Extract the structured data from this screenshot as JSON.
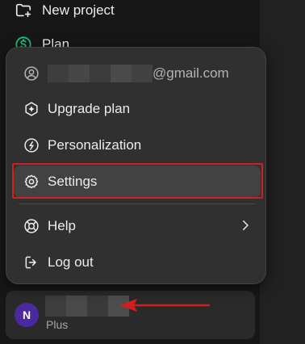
{
  "sidebar": {
    "new_project": {
      "label": "New project",
      "icon": "folder-plus-icon"
    },
    "plan": {
      "label": "Plan",
      "icon": "dollar-circle-icon",
      "icon_color": "#19c37d"
    }
  },
  "menu": {
    "email_suffix": "@gmail.com",
    "items": [
      {
        "label": "Upgrade plan",
        "icon": "sparkle-hexagon-icon"
      },
      {
        "label": "Personalization",
        "icon": "personalization-icon"
      },
      {
        "label": "Settings",
        "icon": "gear-icon",
        "highlighted": true
      },
      {
        "label": "Help",
        "icon": "lifebuoy-icon",
        "has_submenu": true
      },
      {
        "label": "Log out",
        "icon": "logout-icon"
      }
    ]
  },
  "user": {
    "avatar_initial": "N",
    "avatar_color": "#4b2aa0",
    "plan": "Plus"
  },
  "annotation": {
    "color": "#d11f1f"
  }
}
